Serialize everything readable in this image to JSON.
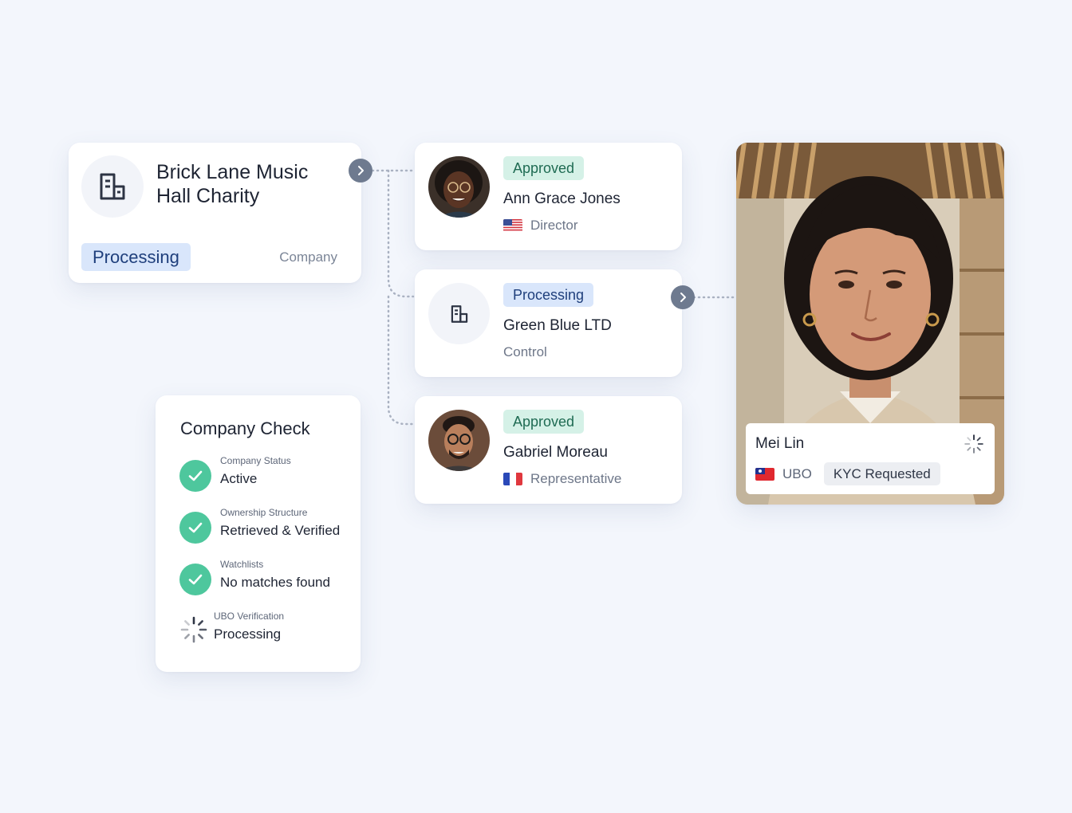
{
  "company": {
    "name": "Brick Lane Music Hall Charity",
    "status": "Processing",
    "type": "Company",
    "icon": "building-icon"
  },
  "people": [
    {
      "status": "Approved",
      "status_color": "#d5f1e7",
      "name": "Ann Grace Jones",
      "role": "Director",
      "flag": "us-flag-icon"
    },
    {
      "status": "Processing",
      "status_color": "#d9e6fb",
      "name": "Green Blue LTD",
      "role": "Control",
      "icon": "building-icon"
    },
    {
      "status": "Approved",
      "status_color": "#d5f1e7",
      "name": "Gabriel Moreau",
      "role": "Representative",
      "flag": "fr-flag-icon"
    }
  ],
  "company_check": {
    "title": "Company Check",
    "items": [
      {
        "label": "Company Status",
        "value": "Active",
        "state": "done"
      },
      {
        "label": "Ownership Structure",
        "value": "Retrieved & Verified",
        "state": "done"
      },
      {
        "label": "Watchlists",
        "value": "No matches found",
        "state": "done"
      },
      {
        "label": "UBO Verification",
        "value": "Processing",
        "state": "loading"
      }
    ]
  },
  "ubo": {
    "name": "Mei Lin",
    "role": "UBO",
    "status": "KYC Requested",
    "flag": "tw-flag-icon"
  },
  "colors": {
    "background": "#f3f6fc",
    "check_green": "#4ec79d",
    "approved_bg": "#d5f1e7",
    "processing_bg": "#d9e6fb",
    "connector": "#6e7a8f"
  }
}
